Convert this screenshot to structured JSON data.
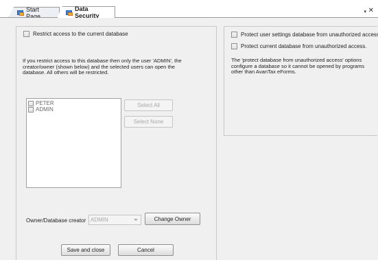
{
  "tabs": [
    {
      "label": "Start Page",
      "icon": "page-icon",
      "active": false
    },
    {
      "label": "Data Security",
      "icon": "page-icon",
      "active": true
    }
  ],
  "tab_controls": {
    "dropdown_icon": "▾",
    "close_icon": "✕"
  },
  "left": {
    "restrict_label": "Restrict access to the current database",
    "info_lines": [
      "If you restrict access to this database then only the user 'ADMIN', the",
      "creator/owner (shown below) and the selected users can open the",
      "database. All others will be restricted."
    ],
    "users": [
      "PETER",
      "ADMIN"
    ],
    "select_all": "Select All",
    "select_none": "Select None",
    "owner_label": "Owner/Database creator",
    "owner_value": "ADMIN",
    "change_owner": "Change Owner",
    "save_close": "Save and close",
    "cancel": "Cancel"
  },
  "right": {
    "protect_user_settings": "Protect user settings database from unauthorized access.",
    "protect_current_db": "Protect current database from unauthorized access.",
    "note_lines": [
      "The 'protect database from unauthorized access' options",
      "configure a database so it cannot be opened by programs",
      "other than AvanTax eForms."
    ]
  }
}
